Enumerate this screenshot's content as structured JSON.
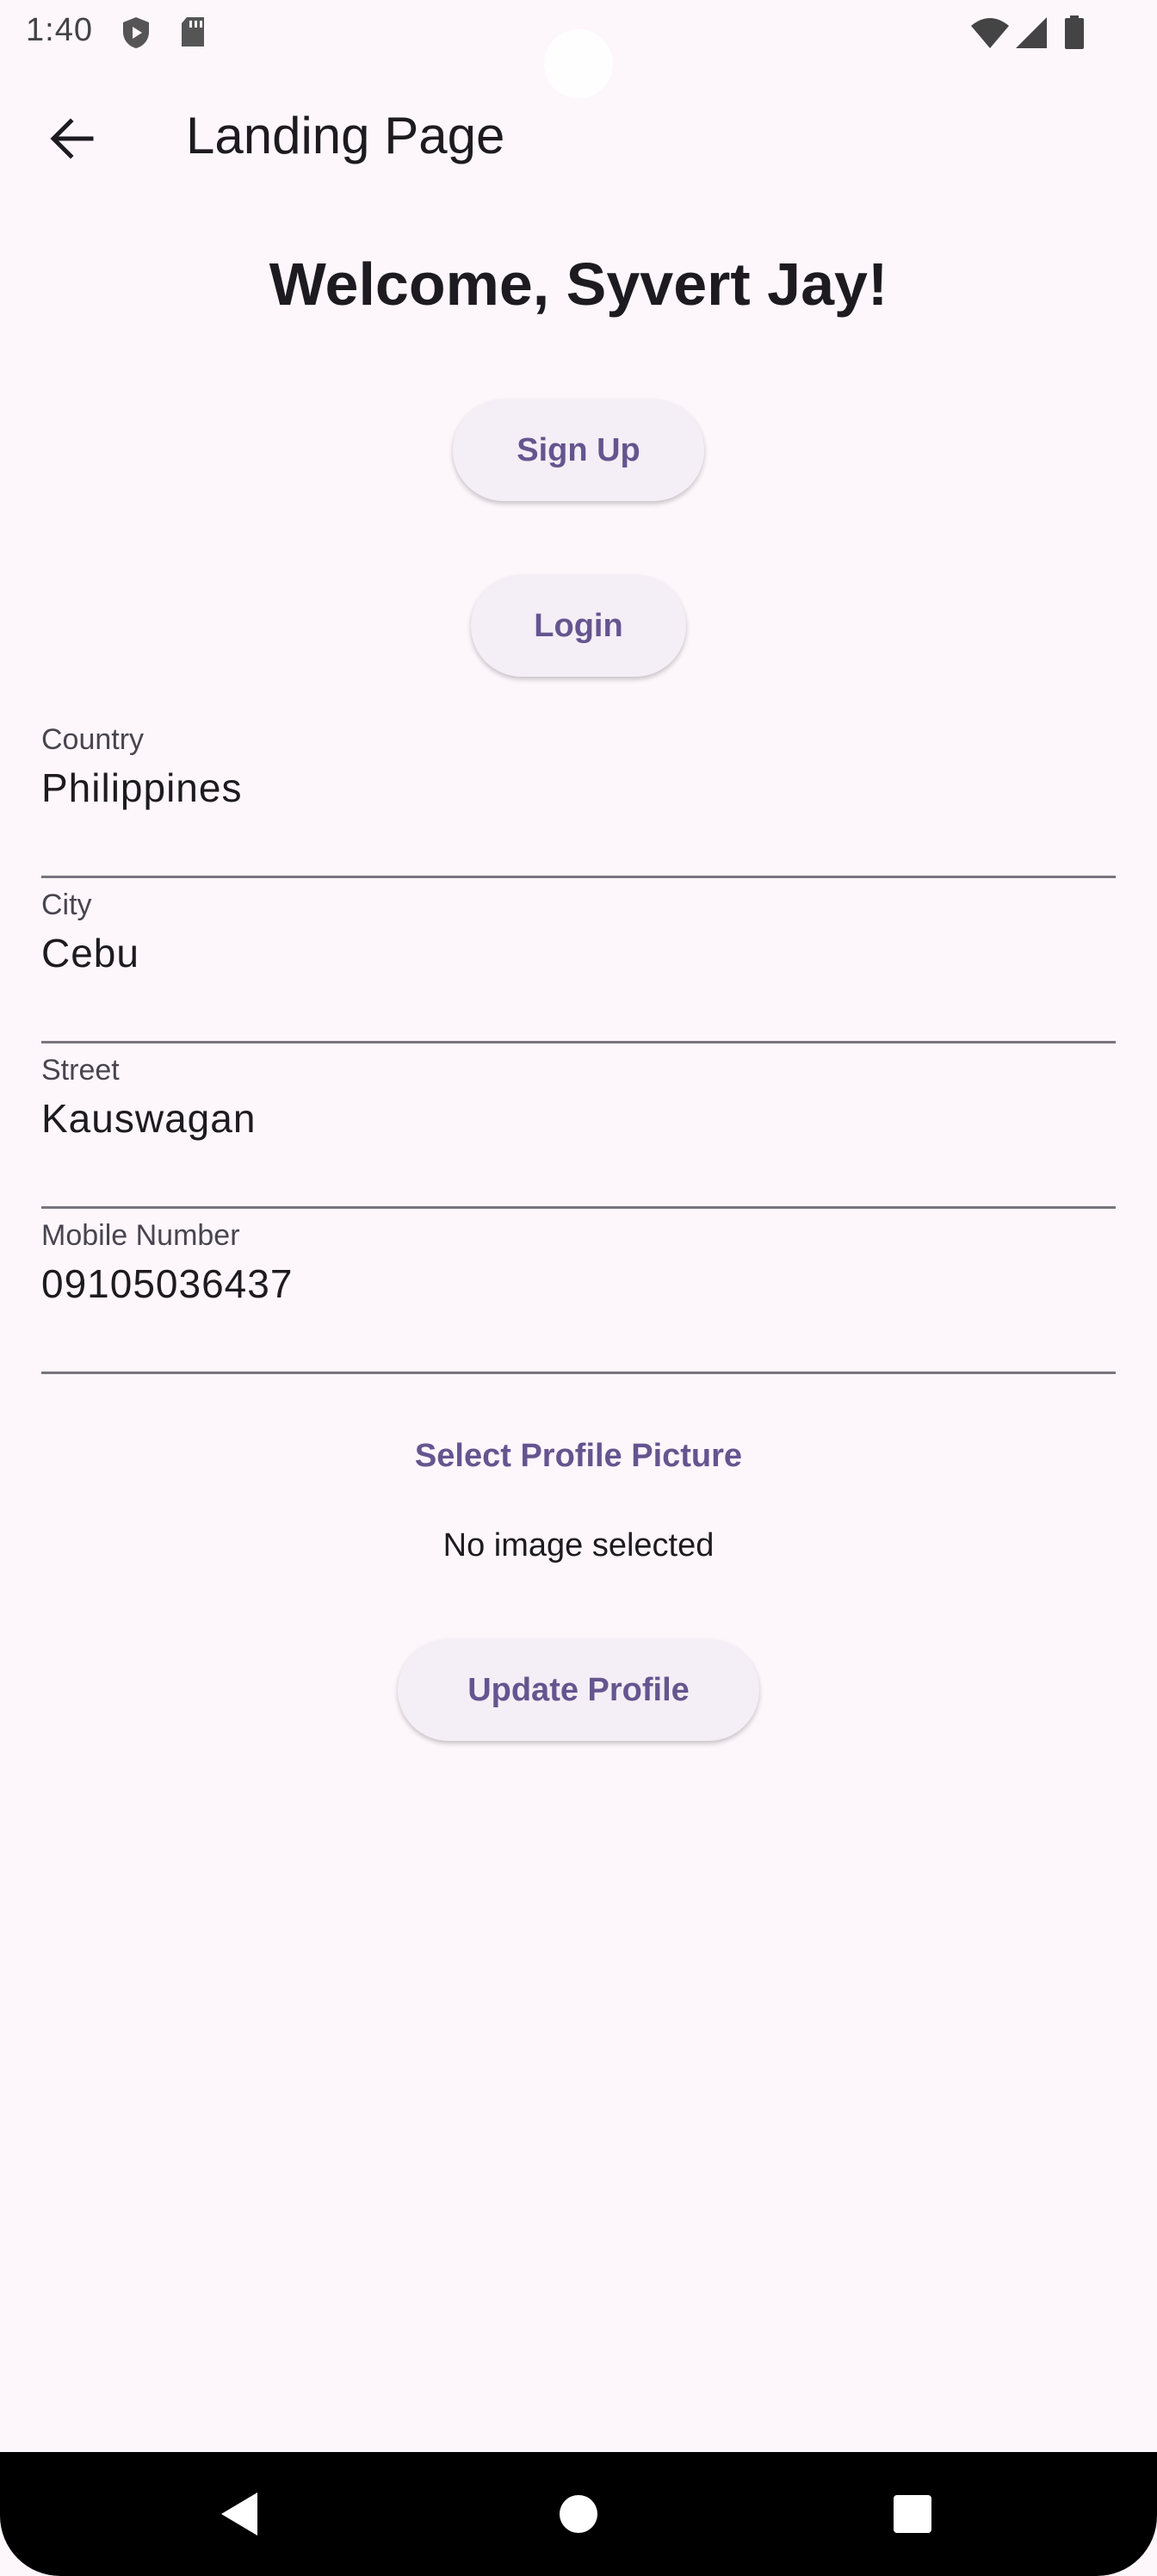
{
  "status_bar": {
    "time": "1:40",
    "icons": [
      "shield-icon",
      "sd-card-icon",
      "wifi-icon",
      "cell-signal-icon",
      "battery-icon"
    ]
  },
  "app_bar": {
    "title": "Landing Page",
    "back_icon": "arrow-back-icon"
  },
  "welcome_text": "Welcome, Syvert Jay!",
  "buttons": {
    "sign_up": "Sign Up",
    "login": "Login",
    "select_picture": "Select Profile Picture",
    "update_profile": "Update Profile"
  },
  "fields": [
    {
      "label": "Country",
      "value": "Philippines"
    },
    {
      "label": "City",
      "value": "Cebu"
    },
    {
      "label": "Street",
      "value": "Kauswagan"
    },
    {
      "label": "Mobile Number",
      "value": "09105036437"
    }
  ],
  "image_status": "No image selected",
  "nav_bar": {
    "icons": [
      "back-triangle-icon",
      "home-circle-icon",
      "recents-square-icon"
    ]
  },
  "colors": {
    "background": "#fdf7fc",
    "accent": "#65558f",
    "button_bg": "#f4eff6",
    "text": "#1d1b20"
  }
}
